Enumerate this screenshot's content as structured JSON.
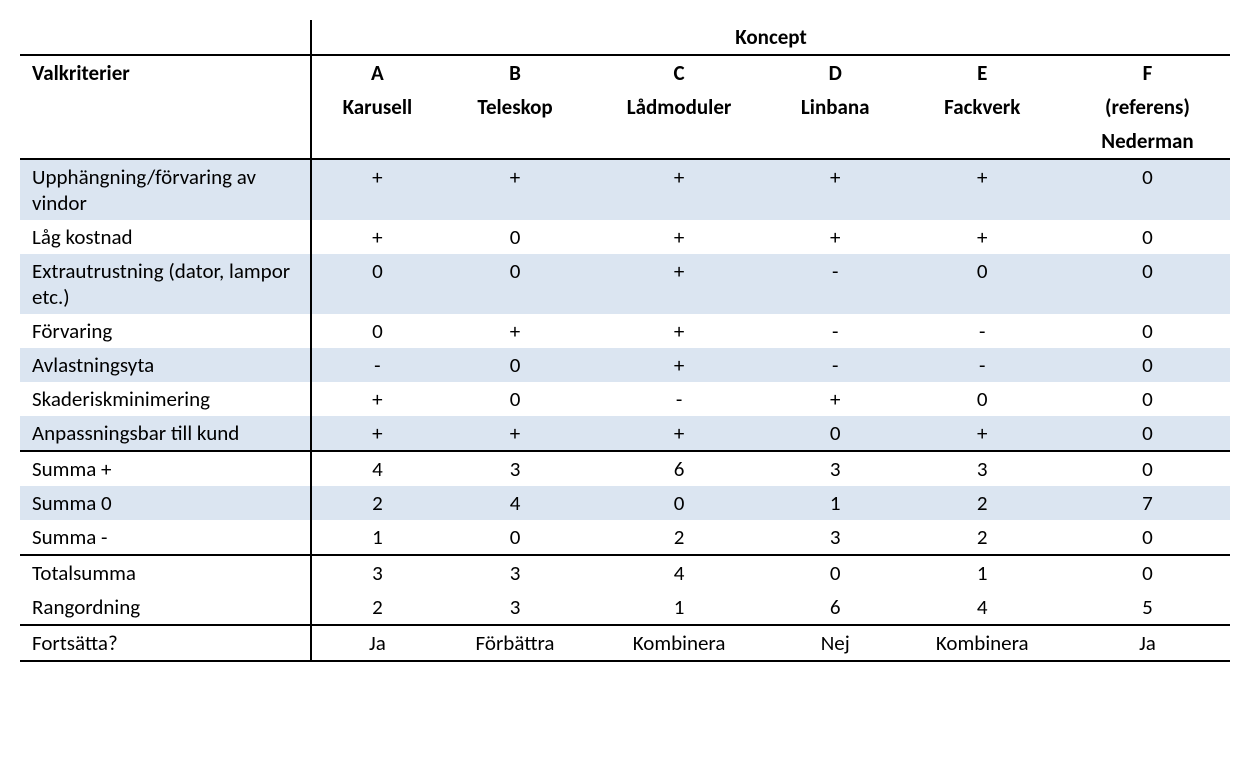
{
  "header": {
    "koncept": "Koncept",
    "valkriterier": "Valkriterier"
  },
  "columns": [
    {
      "letter": "A",
      "name": "Karusell",
      "extra": ""
    },
    {
      "letter": "B",
      "name": "Teleskop",
      "extra": ""
    },
    {
      "letter": "C",
      "name": "Lådmoduler",
      "extra": ""
    },
    {
      "letter": "D",
      "name": "Linbana",
      "extra": ""
    },
    {
      "letter": "E",
      "name": "Fackverk",
      "extra": ""
    },
    {
      "letter": "F",
      "name": "(referens)",
      "extra": "Nederman"
    }
  ],
  "criteria": [
    {
      "label": "Upphängning/förvaring av vindor",
      "values": [
        "+",
        "+",
        "+",
        "+",
        "+",
        "0"
      ]
    },
    {
      "label": "Låg kostnad",
      "values": [
        "+",
        "0",
        "+",
        "+",
        "+",
        "0"
      ]
    },
    {
      "label": "Extrautrustning (dator, lampor etc.)",
      "values": [
        "0",
        "0",
        "+",
        "-",
        "0",
        "0"
      ]
    },
    {
      "label": "Förvaring",
      "values": [
        "0",
        "+",
        "+",
        "-",
        "-",
        "0"
      ]
    },
    {
      "label": "Avlastningsyta",
      "values": [
        "-",
        "0",
        "+",
        "-",
        "-",
        "0"
      ]
    },
    {
      "label": "Skaderiskminimering",
      "values": [
        "+",
        "0",
        "-",
        "+",
        "0",
        "0"
      ]
    },
    {
      "label": "Anpassningsbar till kund",
      "values": [
        "+",
        "+",
        "+",
        "0",
        "+",
        "0"
      ]
    }
  ],
  "sums": {
    "plus": {
      "label": "Summa +",
      "values": [
        "4",
        "3",
        "6",
        "3",
        "3",
        "0"
      ]
    },
    "zero": {
      "label": "Summa 0",
      "values": [
        "2",
        "4",
        "0",
        "1",
        "2",
        "7"
      ]
    },
    "minus": {
      "label": "Summa -",
      "values": [
        "1",
        "0",
        "2",
        "3",
        "2",
        "0"
      ]
    }
  },
  "totals": {
    "total": {
      "label": "Totalsumma",
      "values": [
        "3",
        "3",
        "4",
        "0",
        "1",
        "0"
      ]
    },
    "rank": {
      "label": "Rangordning",
      "values": [
        "2",
        "3",
        "1",
        "6",
        "4",
        "5"
      ]
    }
  },
  "continue": {
    "label": "Fortsätta?",
    "values": [
      "Ja",
      "Förbättra",
      "Kombinera",
      "Nej",
      "Kombinera",
      "Ja"
    ]
  }
}
